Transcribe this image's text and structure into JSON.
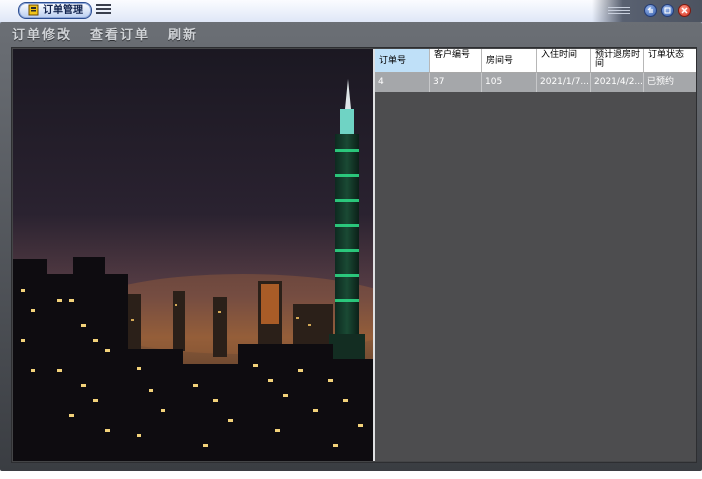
{
  "window": {
    "title": "订单管理"
  },
  "toolbar": {
    "items": [
      "订单修改",
      "查看订单",
      "刷新"
    ]
  },
  "grid": {
    "columns": [
      "订单号",
      "客户编号",
      "房间号",
      "入住时间",
      "预计退房时间",
      "订单状态"
    ],
    "rows": [
      [
        "4",
        "37",
        "105",
        "2021/1/7...",
        "2021/4/2...",
        "已预约"
      ]
    ]
  },
  "colors": {
    "frame": "#4a4d52",
    "header_selected": "#bfe0f8",
    "row_bg": "#a5a7aa",
    "close_button": "#d12b18"
  }
}
